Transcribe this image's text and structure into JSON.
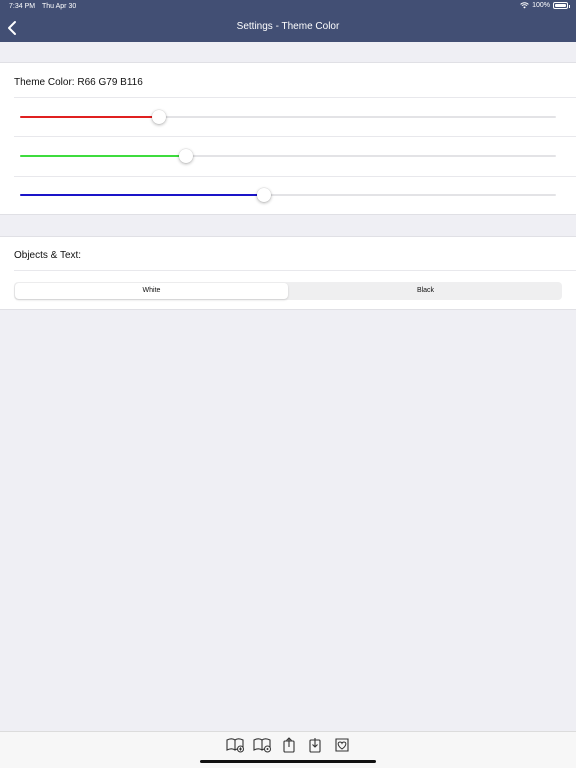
{
  "status_bar": {
    "time": "7:34 PM",
    "date": "Thu Apr 30",
    "battery": "100%",
    "icons": [
      "wifi-icon",
      "battery-icon"
    ]
  },
  "nav": {
    "title": "Settings - Theme Color",
    "back_icon": "chevron-left-icon"
  },
  "theme": {
    "label": "Theme Color: R66 G79 B116",
    "sliders": [
      {
        "name": "red",
        "value": 66,
        "max": 255,
        "color": "#e02020"
      },
      {
        "name": "green",
        "value": 79,
        "max": 255,
        "color": "#3ddc3d"
      },
      {
        "name": "blue",
        "value": 116,
        "max": 255,
        "color": "#1a14c8"
      }
    ],
    "theme_color": "#424f74"
  },
  "objects_text": {
    "label": "Objects & Text:",
    "segments": [
      "White",
      "Black"
    ],
    "selected": "White"
  },
  "toolbar": {
    "icons": [
      "book-add-icon",
      "book-settings-icon",
      "share-icon",
      "import-icon",
      "favorite-icon"
    ]
  }
}
